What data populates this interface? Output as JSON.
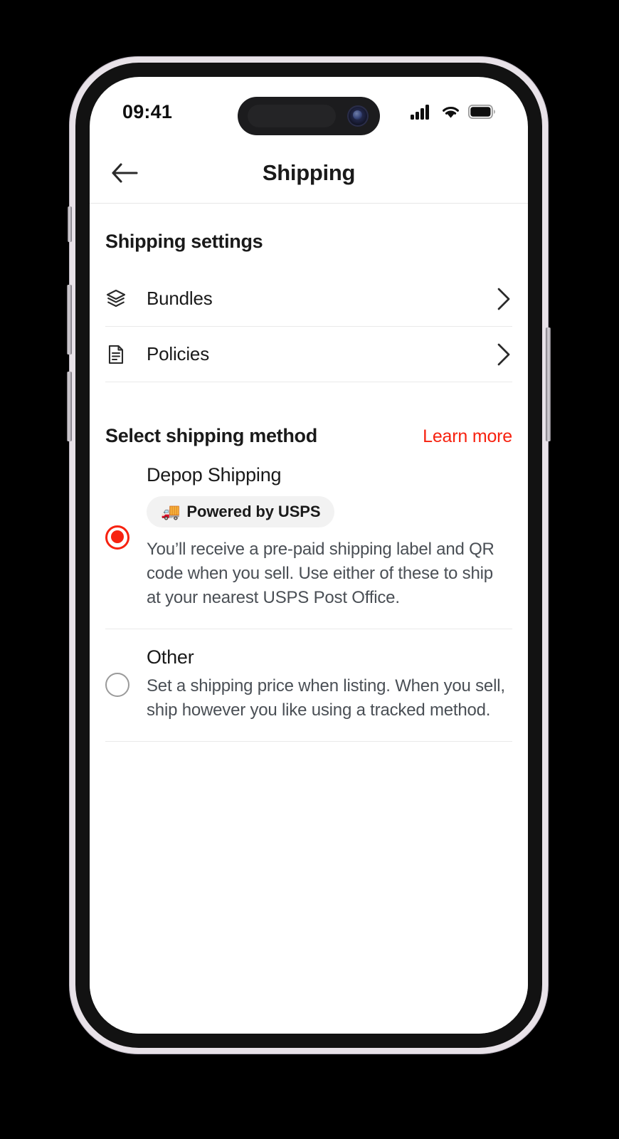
{
  "status_bar": {
    "time": "09:41",
    "icons": [
      "cellular-signal-icon",
      "wifi-icon",
      "battery-icon"
    ]
  },
  "header": {
    "title": "Shipping",
    "back_icon": "arrow-left-icon"
  },
  "shipping_settings": {
    "title": "Shipping settings",
    "rows": [
      {
        "label": "Bundles",
        "icon": "layers-stack-icon",
        "chevron": "chevron-right-icon"
      },
      {
        "label": "Policies",
        "icon": "document-icon",
        "chevron": "chevron-right-icon"
      }
    ]
  },
  "shipping_method": {
    "title": "Select shipping method",
    "learn_more": "Learn more",
    "options": [
      {
        "title": "Depop Shipping",
        "badge": {
          "text": "Powered by USPS",
          "icon": "delivery-truck-icon"
        },
        "description": "You’ll receive a pre-paid shipping label and QR code when you sell. Use either of these to ship at your nearest USPS Post Office.",
        "selected": true
      },
      {
        "title": "Other",
        "description": "Set a shipping price when listing. When you sell, ship however you like using a tracked method.",
        "selected": false
      }
    ]
  },
  "colors": {
    "accent_red": "#F72210",
    "text_primary": "#1a1a1a",
    "text_secondary": "#4a4f55",
    "divider": "#eaeaea",
    "badge_bg": "#f2f2f2"
  }
}
